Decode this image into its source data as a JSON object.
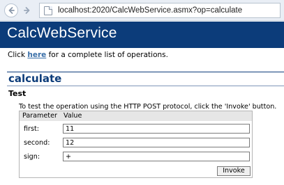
{
  "browser": {
    "url": "localhost:2020/CalcWebService.asmx?op=calculate",
    "back_icon": "arrow-left-icon",
    "forward_icon": "arrow-right-icon",
    "page_icon": "page-icon"
  },
  "header": {
    "title": "CalcWebService",
    "color": "#0c3c7a"
  },
  "intro": {
    "prefix": "Click ",
    "link": "here",
    "suffix": " for a complete list of operations."
  },
  "operation": {
    "title": "calculate",
    "test_heading": "Test",
    "description": "To test the operation using the HTTP POST protocol, click the 'Invoke' button."
  },
  "form": {
    "columns": [
      "Parameter",
      "Value"
    ],
    "fields": [
      {
        "label": "first:",
        "value": "11"
      },
      {
        "label": "second:",
        "value": "12"
      },
      {
        "label": "sign:",
        "value": "+"
      }
    ],
    "invoke_label": "Invoke"
  }
}
